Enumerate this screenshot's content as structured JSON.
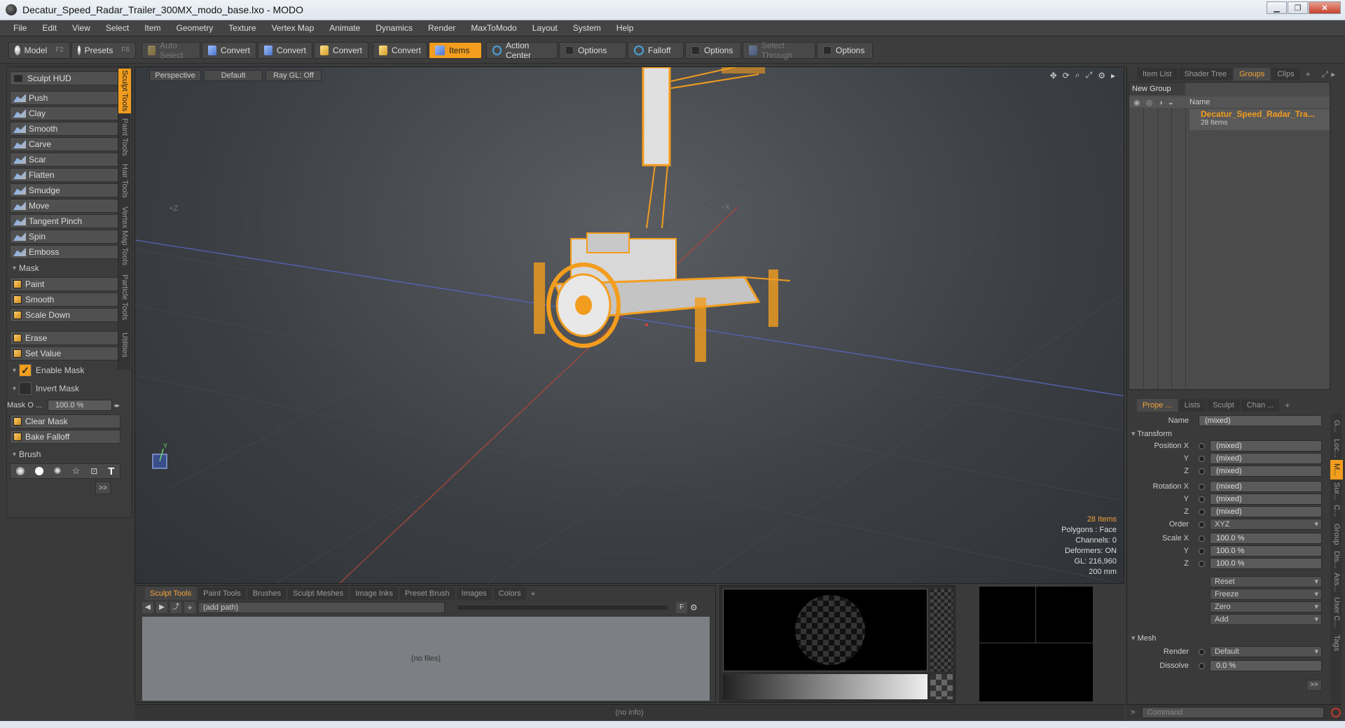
{
  "window": {
    "title": "Decatur_Speed_Radar_Trailer_300MX_modo_base.lxo - MODO"
  },
  "menu": [
    "File",
    "Edit",
    "View",
    "Select",
    "Item",
    "Geometry",
    "Texture",
    "Vertex Map",
    "Animate",
    "Dynamics",
    "Render",
    "MaxToModo",
    "Layout",
    "System",
    "Help"
  ],
  "toolbar": {
    "model": "Model",
    "model_key": "F2",
    "presets": "Presets",
    "presets_key": "F6",
    "auto_select": "Auto Select",
    "convert1": "Convert",
    "convert2": "Convert",
    "convert3": "Convert",
    "convert4": "Convert",
    "items": "Items",
    "action_center": "Action Center",
    "options1": "Options",
    "falloff": "Falloff",
    "options2": "Options",
    "select_through": "Select Through",
    "options3": "Options"
  },
  "left": {
    "hud": "Sculpt HUD",
    "tools": [
      "Push",
      "Clay",
      "Smooth",
      "Carve",
      "Scar",
      "Flatten",
      "Smudge",
      "Move",
      "Tangent Pinch",
      "Spin",
      "Emboss"
    ],
    "mask_section": "Mask",
    "mask_tools": [
      "Paint",
      "Smooth",
      "Scale Down"
    ],
    "erase": "Erase",
    "set_value": "Set Value",
    "enable_mask": "Enable Mask",
    "invert_mask": "Invert Mask",
    "mask_opacity_label": "Mask O ...",
    "mask_opacity_value": "100.0 %",
    "clear_mask": "Clear Mask",
    "bake_falloff": "Bake Falloff",
    "brush_section": "Brush",
    "more": ">>"
  },
  "vtabs": [
    "Sculpt Tools",
    "Paint Tools",
    "Hair Tools",
    "Vertex Map Tools",
    "Particle Tools",
    "Utilities"
  ],
  "viewport": {
    "perspective": "Perspective",
    "default": "Default",
    "raygl": "Ray GL: Off",
    "stats": {
      "items": "28 Items",
      "polygons": "Polygons : Face",
      "channels": "Channels: 0",
      "deformers": "Deformers: ON",
      "gl": "GL: 216,960",
      "size": "200 mm"
    }
  },
  "bottom": {
    "tabs": [
      "Sculpt Tools",
      "Paint Tools",
      "Brushes",
      "Sculpt Meshes",
      "Image Inks",
      "Preset Brush",
      "Images",
      "Colors"
    ],
    "add_tab": "+",
    "path": "(add path)",
    "f_btn": "F",
    "no_files": "(no files)"
  },
  "status": {
    "info": "(no info)",
    "command_placeholder": "Command",
    "prompt": ">"
  },
  "right": {
    "tabs_top": [
      "Item List",
      "Shader Tree",
      "Groups",
      "Clips"
    ],
    "new_group": "New Group",
    "name_col": "Name",
    "group_name": "Decatur_Speed_Radar_Tra...",
    "group_count": "28 Items",
    "tabs_props": [
      "Prope ...",
      "Lists",
      "Sculpt",
      "Chan ..."
    ],
    "name_label": "Name",
    "name_value": "(mixed)",
    "transform": "Transform",
    "position_x": "Position X",
    "rotation_x": "Rotation X",
    "scale_x": "Scale X",
    "y": "Y",
    "z": "Z",
    "mixed": "(mixed)",
    "order_label": "Order",
    "order_value": "XYZ",
    "scale_value": "100.0 %",
    "reset": "Reset",
    "freeze": "Freeze",
    "zero": "Zero",
    "add": "Add",
    "mesh": "Mesh",
    "render_label": "Render",
    "render_value": "Default",
    "dissolve_label": "Dissolve",
    "dissolve_value": "0.0 %",
    "more": ">>",
    "side_tabs": [
      "G...",
      "Loc...",
      "M...",
      "Sur...",
      "C...",
      "Group",
      "Dis...",
      "Ass...",
      "User C...",
      "Tags"
    ]
  }
}
